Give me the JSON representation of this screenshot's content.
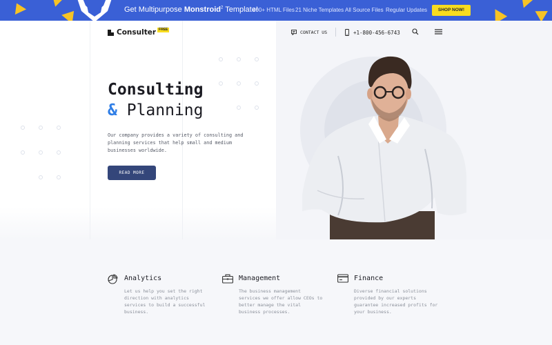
{
  "promo": {
    "text_prefix": "Get Multipurpose ",
    "brand": "Monstroid",
    "brand_sup": "2",
    "text_suffix": " Template!",
    "features": [
      "400+ HTML Files",
      "21 Niche Templates",
      "All Source Files",
      "Regular Updates"
    ],
    "button_label": "SHOP NOW!",
    "colors": {
      "bar": "#3a60d6",
      "accent": "#f8dc1f"
    }
  },
  "header": {
    "logo_name": "Consulter",
    "logo_badge": "FREE",
    "contact_label": "CONTACT US",
    "phone": "+1-800-456-6743",
    "icons": [
      "chat-icon",
      "phone-icon",
      "search-icon",
      "hamburger-menu-icon"
    ]
  },
  "hero": {
    "title_line1": "Consulting",
    "title_amp": "&",
    "title_line2": "Planning",
    "description": "Our company provides a variety of consulting and planning services that help small and medium businesses worldwide.",
    "button_label": "READ MORE",
    "colors": {
      "amp": "#2f7ee6",
      "button": "#34467a"
    }
  },
  "services": [
    {
      "icon": "pie-chart-icon",
      "title": "Analytics",
      "description": "Let us help you set the right direction with analytics services to build a successful business."
    },
    {
      "icon": "briefcase-icon",
      "title": "Management",
      "description": "The business management services we offer allow CEOs to better manage the vital business processes."
    },
    {
      "icon": "credit-card-icon",
      "title": "Finance",
      "description": "Diverse financial solutions provided by our experts guarantee increased profits for your business."
    }
  ]
}
